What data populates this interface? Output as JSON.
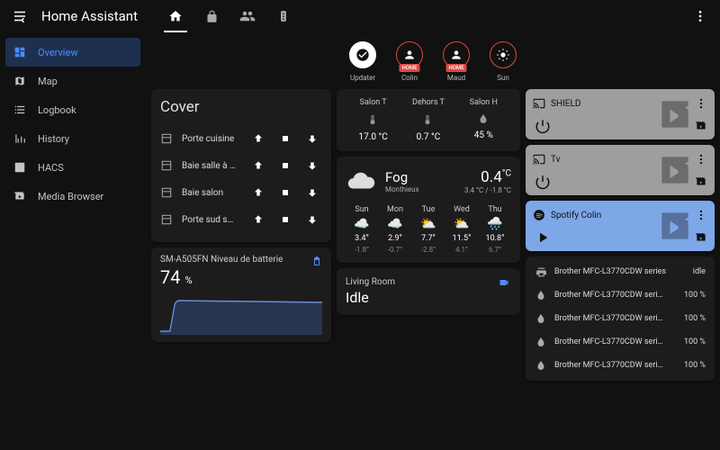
{
  "app_title": "Home Assistant",
  "sidebar": {
    "items": [
      {
        "label": "Overview",
        "active": true
      },
      {
        "label": "Map"
      },
      {
        "label": "Logbook"
      },
      {
        "label": "History"
      },
      {
        "label": "HACS"
      },
      {
        "label": "Media Browser"
      }
    ]
  },
  "badges": [
    {
      "label": "Updater",
      "style": "on"
    },
    {
      "label": "Colin",
      "style": "red",
      "tag": "HOME"
    },
    {
      "label": "Maud",
      "style": "red",
      "tag": "HOME"
    },
    {
      "label": "Sun",
      "style": "red"
    }
  ],
  "cover": {
    "title": "Cover",
    "rows": [
      {
        "name": "Porte cuisine"
      },
      {
        "name": "Baie salle à …"
      },
      {
        "name": "Baie salon"
      },
      {
        "name": "Porte sud s…"
      }
    ]
  },
  "battery": {
    "title": "SM-A505FN Niveau de batterie",
    "value": "74",
    "unit": "%"
  },
  "sensors": {
    "cols": [
      {
        "name": "Salon T",
        "icon": "therm",
        "value": "17.0 °C"
      },
      {
        "name": "Dehors T",
        "icon": "therm",
        "value": "0.7 °C"
      },
      {
        "name": "Salon H",
        "icon": "drop",
        "value": "45 %"
      }
    ]
  },
  "weather": {
    "condition": "Fog",
    "location": "Monthieux",
    "temp": "0.4",
    "temp_unit": "°C",
    "hilo": "3.4 °C / -1.8 °C",
    "forecast": [
      {
        "d": "Sun",
        "hi": "3.4°",
        "lo": "-1.8°",
        "icon": "cloud"
      },
      {
        "d": "Mon",
        "hi": "2.9°",
        "lo": "-0.7°",
        "icon": "cloud"
      },
      {
        "d": "Tue",
        "hi": "7.7°",
        "lo": "-2.8°",
        "icon": "partly"
      },
      {
        "d": "Wed",
        "hi": "11.5°",
        "lo": "4.1°",
        "icon": "partly"
      },
      {
        "d": "Thu",
        "hi": "10.8°",
        "lo": "6.7°",
        "icon": "rain"
      }
    ]
  },
  "living_room": {
    "title": "Living Room",
    "state": "Idle"
  },
  "media": [
    {
      "title": "SHIELD",
      "ctrl": "power",
      "tone": "gray"
    },
    {
      "title": "Tv",
      "ctrl": "power",
      "tone": "gray"
    },
    {
      "title": "Spotify Colin",
      "ctrl": "play",
      "tone": "blue"
    }
  ],
  "printer": {
    "rows": [
      {
        "icon": "printer",
        "name": "Brother MFC-L3770CDW series",
        "value": "idle"
      },
      {
        "icon": "drop",
        "name": "Brother MFC-L3770CDW seri…",
        "value": "100 %"
      },
      {
        "icon": "drop",
        "name": "Brother MFC-L3770CDW seri…",
        "value": "100 %"
      },
      {
        "icon": "drop",
        "name": "Brother MFC-L3770CDW seri…",
        "value": "100 %"
      },
      {
        "icon": "drop",
        "name": "Brother MFC-L3770CDW seri…",
        "value": "100 %"
      }
    ]
  }
}
